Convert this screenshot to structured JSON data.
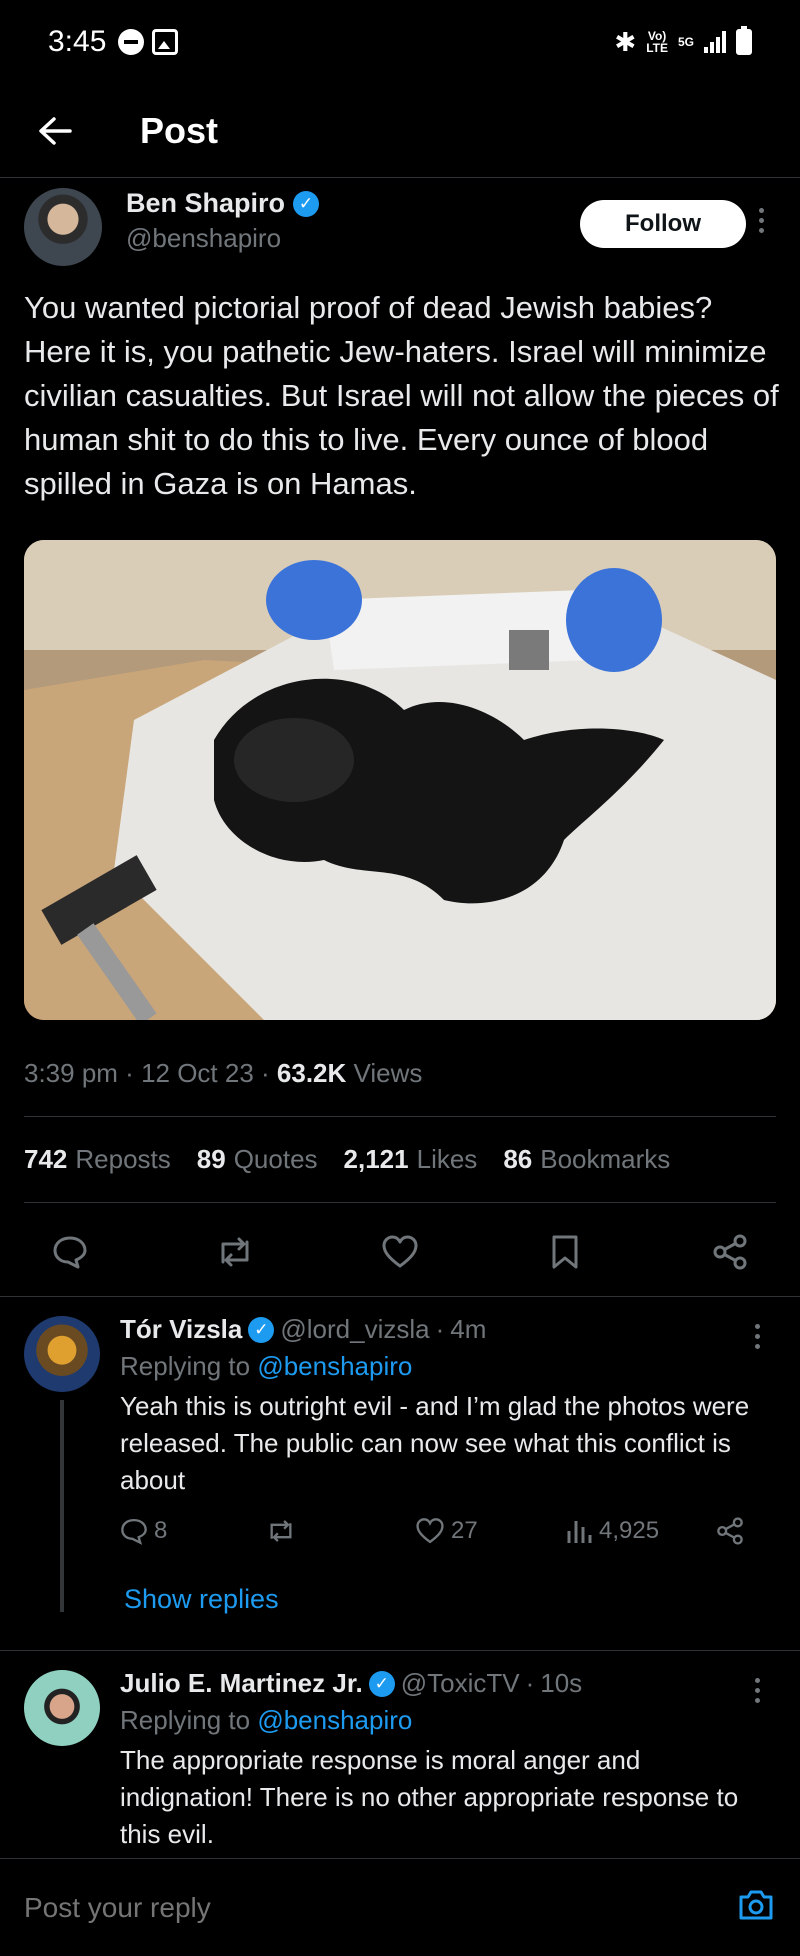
{
  "status_bar": {
    "time": "3:45",
    "network_top": "Vo)",
    "network_bottom": "LTE",
    "network_5g": "5G"
  },
  "nav": {
    "title": "Post"
  },
  "post": {
    "author_name": "Ben Shapiro",
    "author_handle": "@benshapiro",
    "follow_label": "Follow",
    "text": "You wanted pictorial proof of dead Jewish babies? Here it is, you pathetic Jew-haters. Israel will minimize civilian casualties. But Israel will not allow the pieces of human shit to do this to live. Every ounce of blood spilled in Gaza is on Hamas.",
    "time": "3:39 pm",
    "date": "12 Oct 23",
    "views_count": "63.2K",
    "views_label": "Views",
    "reposts_count": "742",
    "reposts_label": "Reposts",
    "quotes_count": "89",
    "quotes_label": "Quotes",
    "likes_count": "2,121",
    "likes_label": "Likes",
    "bookmarks_count": "86",
    "bookmarks_label": "Bookmarks"
  },
  "replies": [
    {
      "name": "Tór Vizsla",
      "handle": "@lord_vizsla",
      "time": "4m",
      "replying_prefix": "Replying to",
      "replying_to": "@benshapiro",
      "text": "Yeah this is outright evil - and I’m glad the photos were released.  The public can now see what this conflict is about",
      "reply_count": "8",
      "like_count": "27",
      "view_count": "4,925",
      "show_replies": "Show replies"
    },
    {
      "name": "Julio E. Martinez Jr.",
      "handle": "@ToxicTV",
      "time": "10s",
      "replying_prefix": "Replying to",
      "replying_to": "@benshapiro",
      "text": "The appropriate response is moral anger and indignation! There is no other appropriate response to this evil."
    }
  ],
  "reply_bar": {
    "placeholder": "Post your reply"
  },
  "colors": {
    "accent": "#1d9bf0",
    "background": "#000000",
    "muted": "#71767b"
  }
}
